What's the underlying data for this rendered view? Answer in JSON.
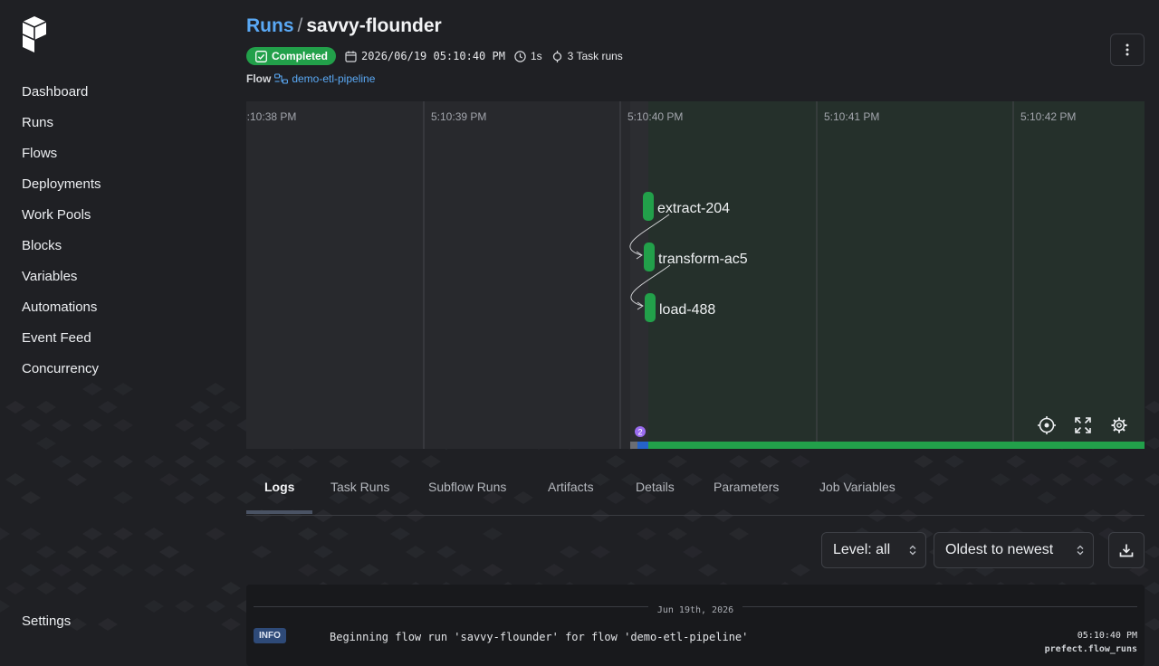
{
  "nav": {
    "items": [
      {
        "label": "Dashboard"
      },
      {
        "label": "Runs"
      },
      {
        "label": "Flows"
      },
      {
        "label": "Deployments"
      },
      {
        "label": "Work Pools"
      },
      {
        "label": "Blocks"
      },
      {
        "label": "Variables"
      },
      {
        "label": "Automations"
      },
      {
        "label": "Event Feed"
      },
      {
        "label": "Concurrency"
      }
    ],
    "settings": "Settings"
  },
  "header": {
    "breadcrumb": "Runs",
    "separator": "/",
    "run_name": "savvy-flounder",
    "state": "Completed",
    "start_time": "2026/06/19 05:10:40 PM",
    "duration": "1s",
    "task_runs": "3 Task runs",
    "flow_label": "Flow",
    "flow_name": "demo-etl-pipeline"
  },
  "timeline": {
    "ticks": [
      "5:10:38 PM",
      "5:10:39 PM",
      "5:10:40 PM",
      "5:10:41 PM",
      "5:10:42 PM"
    ],
    "nodes": [
      {
        "label": "extract-204"
      },
      {
        "label": "transform-ac5"
      },
      {
        "label": "load-488"
      }
    ],
    "event_count": "2",
    "colors": {
      "completed": "#22a04a",
      "running": "#2563c9",
      "event": "#9b6cf0"
    }
  },
  "tabs": [
    {
      "label": "Logs",
      "active": true
    },
    {
      "label": "Task Runs"
    },
    {
      "label": "Subflow Runs"
    },
    {
      "label": "Artifacts"
    },
    {
      "label": "Details"
    },
    {
      "label": "Parameters"
    },
    {
      "label": "Job Variables"
    }
  ],
  "log_controls": {
    "level": "Level: all",
    "order": "Oldest to newest"
  },
  "logs": {
    "date": "Jun 19th, 2026",
    "entries": [
      {
        "level": "INFO",
        "message": "Beginning flow run 'savvy-flounder' for flow 'demo-etl-pipeline'",
        "time": "05:10:40 PM",
        "source": "prefect.flow_runs"
      }
    ]
  }
}
